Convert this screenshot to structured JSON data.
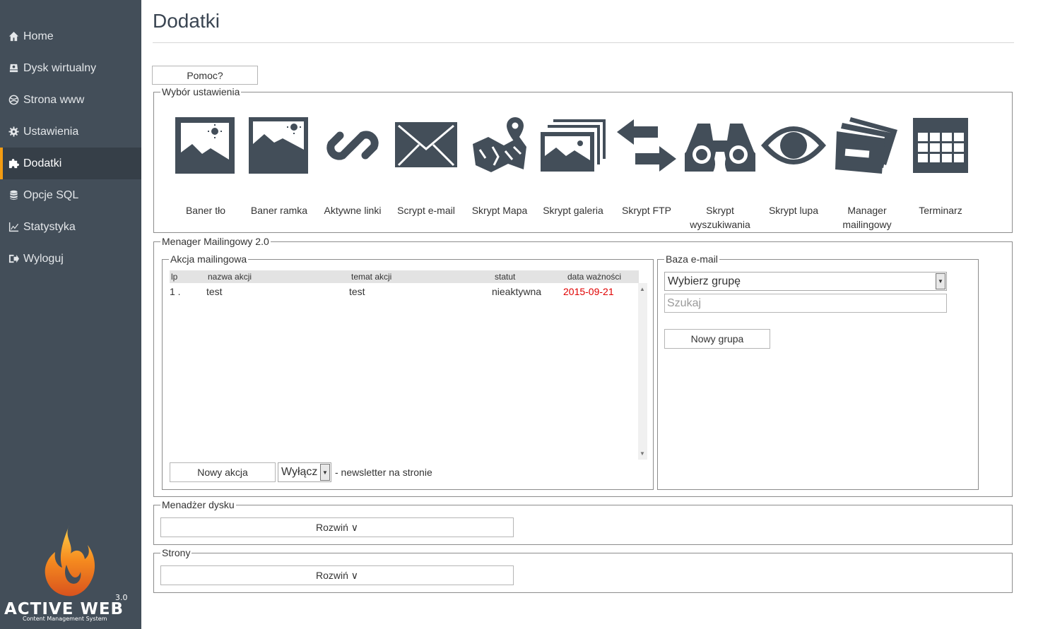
{
  "sidebar": {
    "items": [
      {
        "label": "Home",
        "icon": "home-icon"
      },
      {
        "label": "Dysk wirtualny",
        "icon": "disk-icon"
      },
      {
        "label": "Strona www",
        "icon": "globe-icon"
      },
      {
        "label": "Ustawienia",
        "icon": "gear-icon"
      },
      {
        "label": "Dodatki",
        "icon": "puzzle-icon",
        "active": true
      },
      {
        "label": "Opcje SQL",
        "icon": "database-icon"
      },
      {
        "label": "Statystyka",
        "icon": "chart-icon"
      },
      {
        "label": "Wyloguj",
        "icon": "logout-icon"
      }
    ],
    "active_color": "#f39c12"
  },
  "logo": {
    "text": "ACTIVE WEB",
    "version": "3.0",
    "subtitle": "Content Management System"
  },
  "page": {
    "title": "Dodatki",
    "help_button": "Pomoc?"
  },
  "settings": {
    "legend": "Wybór ustawienia",
    "plugins": [
      {
        "label": "Baner tło",
        "icon": "image-icon"
      },
      {
        "label": "Baner ramka",
        "icon": "image-frame-icon"
      },
      {
        "label": "Aktywne linki",
        "icon": "link-icon"
      },
      {
        "label": "Scrypt e-mail",
        "icon": "envelope-icon"
      },
      {
        "label": "Skrypt Mapa",
        "icon": "map-icon"
      },
      {
        "label": "Skrypt galeria",
        "icon": "gallery-icon"
      },
      {
        "label": "Skrypt FTP",
        "icon": "transfer-arrows-icon"
      },
      {
        "label": "Skrypt wyszukiwania",
        "icon": "binoculars-icon"
      },
      {
        "label": "Skrypt lupa",
        "icon": "eye-icon"
      },
      {
        "label": "Manager mailingowy",
        "icon": "mailing-envelopes-icon"
      },
      {
        "label": "Terminarz",
        "icon": "calendar-icon"
      }
    ]
  },
  "mailing": {
    "legend": "Menager Mailingowy 2.0",
    "action": {
      "legend": "Akcja mailingowa",
      "columns": [
        "lp",
        "nazwa akcji",
        "temat akcji",
        "statut",
        "data ważności"
      ],
      "rows": [
        {
          "lp": "1 .",
          "name": "test",
          "subject": "test",
          "status": "nieaktywna",
          "date": "2015-09-21"
        }
      ],
      "date_color": "#e00000",
      "new_button": "Nowy akcja",
      "toggle_value": "Wyłącz",
      "toggle_suffix": "- newsletter na stronie"
    },
    "base": {
      "legend": "Baza e-mail",
      "group_select": "Wybierz grupę",
      "search_placeholder": "Szukaj",
      "new_group_button": "Nowy grupa"
    }
  },
  "disk_manager": {
    "legend": "Menadżer dysku",
    "expand_button": "Rozwiń ∨"
  },
  "pages": {
    "legend": "Strony",
    "expand_button": "Rozwiń ∨"
  }
}
